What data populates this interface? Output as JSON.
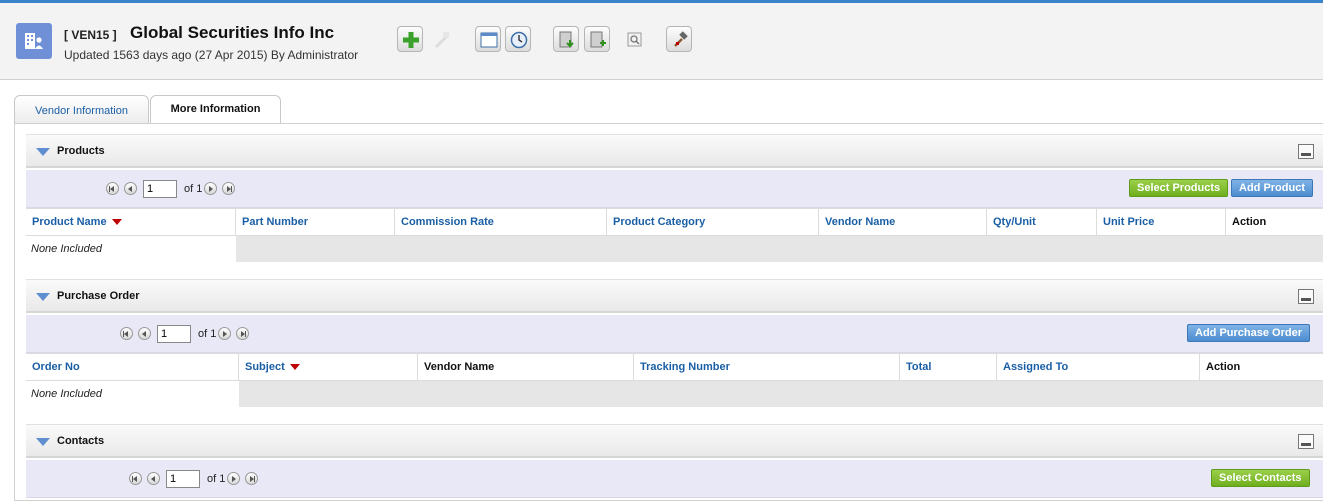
{
  "record": {
    "tag": "[ VEN15 ]",
    "name": "Global Securities Info Inc",
    "updated": "Updated 1563 days ago (27 Apr 2015) By Administrator"
  },
  "toolbar": {
    "icons": [
      "add-icon",
      "duplicate-icon",
      "calendar-icon",
      "clock-icon",
      "import-icon",
      "export-icon",
      "find-duplicates-icon",
      "settings-hammer-icon"
    ]
  },
  "tabs": [
    {
      "label": "Vendor Information",
      "active": false
    },
    {
      "label": "More Information",
      "active": true
    }
  ],
  "sections": {
    "products": {
      "title": "Products",
      "pager": {
        "page": "1",
        "of": "of 1"
      },
      "buttons": {
        "select": "Select Products",
        "add": "Add Product"
      },
      "columns": [
        "Product Name",
        "Part Number",
        "Commission Rate",
        "Product Category",
        "Vendor Name",
        "Qty/Unit",
        "Unit Price",
        "Action"
      ],
      "empty": "None Included"
    },
    "purchase_order": {
      "title": "Purchase Order",
      "pager": {
        "page": "1",
        "of": "of 1"
      },
      "buttons": {
        "add": "Add Purchase Order"
      },
      "columns": [
        "Order No",
        "Subject",
        "Vendor Name",
        "Tracking Number",
        "Total",
        "Assigned To",
        "Action"
      ],
      "empty": "None Included"
    },
    "contacts": {
      "title": "Contacts",
      "pager": {
        "page": "1",
        "of": "of 1"
      },
      "buttons": {
        "select": "Select Contacts"
      }
    }
  },
  "colors": {
    "accent": "#3a82c9",
    "link": "#1a5fa6",
    "green_button": "#6fae1f",
    "blue_button": "#4d8ccf",
    "sort_arrow": "#c00000"
  }
}
